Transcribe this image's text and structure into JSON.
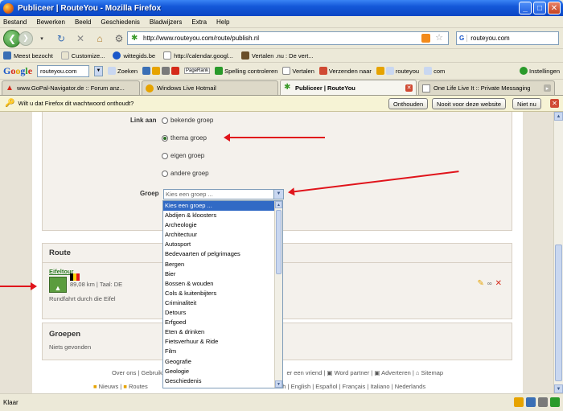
{
  "window": {
    "title": "Publiceer | RouteYou - Mozilla Firefox"
  },
  "menu": [
    "Bestand",
    "Bewerken",
    "Beeld",
    "Geschiedenis",
    "Bladwijzers",
    "Extra",
    "Help"
  ],
  "nav": {
    "url": "http://www.routeyou.com/route/publish.nl",
    "search_engine": "G",
    "search_value": "routeyou.com"
  },
  "bookmarks": [
    {
      "label": "Meest bezocht",
      "color": "#3a6fb5"
    },
    {
      "label": "Customize...",
      "color": "#e9e4cf"
    },
    {
      "label": "wittegids.be",
      "color": "#1a57c9"
    },
    {
      "label": "http://calendar.googl...",
      "color": "#ffffff"
    },
    {
      "label": "Vertalen .nu : De vert...",
      "color": "#6a4f2a"
    }
  ],
  "google_bar": {
    "logo": [
      "G",
      "o",
      "o",
      "g",
      "l",
      "e"
    ],
    "search_value": "routeyou.com",
    "items": [
      "Zoeken",
      "PageRank",
      "Spelling controleren",
      "Vertalen",
      "Verzenden naar",
      "routeyou",
      "com",
      "Instellingen"
    ]
  },
  "tabs": [
    {
      "label": "www.GoPal-Navigator.de :: Forum anz...",
      "active": false
    },
    {
      "label": "Windows Live Hotmail",
      "active": false
    },
    {
      "label": "Publiceer | RouteYou",
      "active": true
    },
    {
      "label": "One Life Live It :: Private Messaging",
      "active": false
    }
  ],
  "notification": {
    "text": "Wilt u dat Firefox dit wachtwoord onthoudt?",
    "btn_remember": "Onthouden",
    "btn_never": "Nooit voor deze website",
    "btn_not_now": "Niet nu"
  },
  "form": {
    "link_label": "Link aan",
    "options": [
      "bekende groep",
      "thema groep",
      "eigen groep",
      "andere groep"
    ],
    "selected_option": "thema groep",
    "group_label": "Groep",
    "group_placeholder": "Kies een groep ..."
  },
  "dropdown_options": [
    "Kies een groep ...",
    "Abdijen & kloosters",
    "Archeologie",
    "Architectuur",
    "Autosport",
    "Bedevaarten of pelgrimages",
    "Bergen",
    "Bier",
    "Bossen & wouden",
    "Cols & kuitenbijters",
    "Criminaliteit",
    "Detours",
    "Erfgoed",
    "Eten & drinken",
    "Fietsverhuur & Ride",
    "Film",
    "Geografie",
    "Geologie",
    "Geschiedenis"
  ],
  "route": {
    "section_title": "Route",
    "name": "Eifeltour",
    "meta": "89,08 km | Taal: DE",
    "description": "Rundfahrt durch die Eifel"
  },
  "groups": {
    "section_title": "Groepen",
    "empty": "Niets gevonden"
  },
  "footer": {
    "line1": [
      "Over ons",
      "Gebruikersvoo",
      "er een vriend",
      "Word partner",
      "Adverteren",
      "Sitemap"
    ],
    "line2": [
      "Nieuws",
      "Routes",
      "Deutsch",
      "English",
      "Español",
      "Français",
      "Italiano",
      "Nederlands"
    ]
  },
  "status": {
    "text": "Klaar"
  },
  "colors": {
    "arrow": "#e0141b",
    "selection": "#316ac5",
    "route_green": "#2d7a24"
  }
}
